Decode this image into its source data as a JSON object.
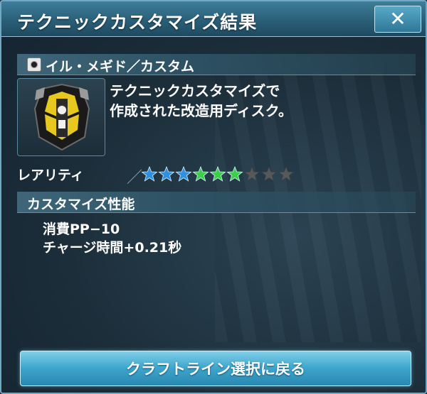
{
  "window": {
    "title": "テクニックカスタマイズ結果",
    "close_symbol": "✕"
  },
  "item": {
    "name": "イル・メギド／カスタム",
    "icon": "disc-icon",
    "description": "テクニックカスタマイズで\n作成された改造用ディスク。"
  },
  "rarity": {
    "label": "レアリティ",
    "separator": "／",
    "level": 6,
    "max": 9,
    "star_colors": [
      "#2f8fe0",
      "#2f8fe0",
      "#2f8fe0",
      "#3ccf4a",
      "#3ccf4a",
      "#3ccf4a",
      "#55595c",
      "#55595c",
      "#55595c"
    ]
  },
  "performance": {
    "header": "カスタマイズ性能",
    "lines": [
      "消費PP−10",
      "チャージ時間+0.21秒"
    ]
  },
  "actions": {
    "back_label": "クラフトライン選択に戻る"
  },
  "colors": {
    "accent": "#3da4cb",
    "title_bar": "#2a5f78"
  }
}
